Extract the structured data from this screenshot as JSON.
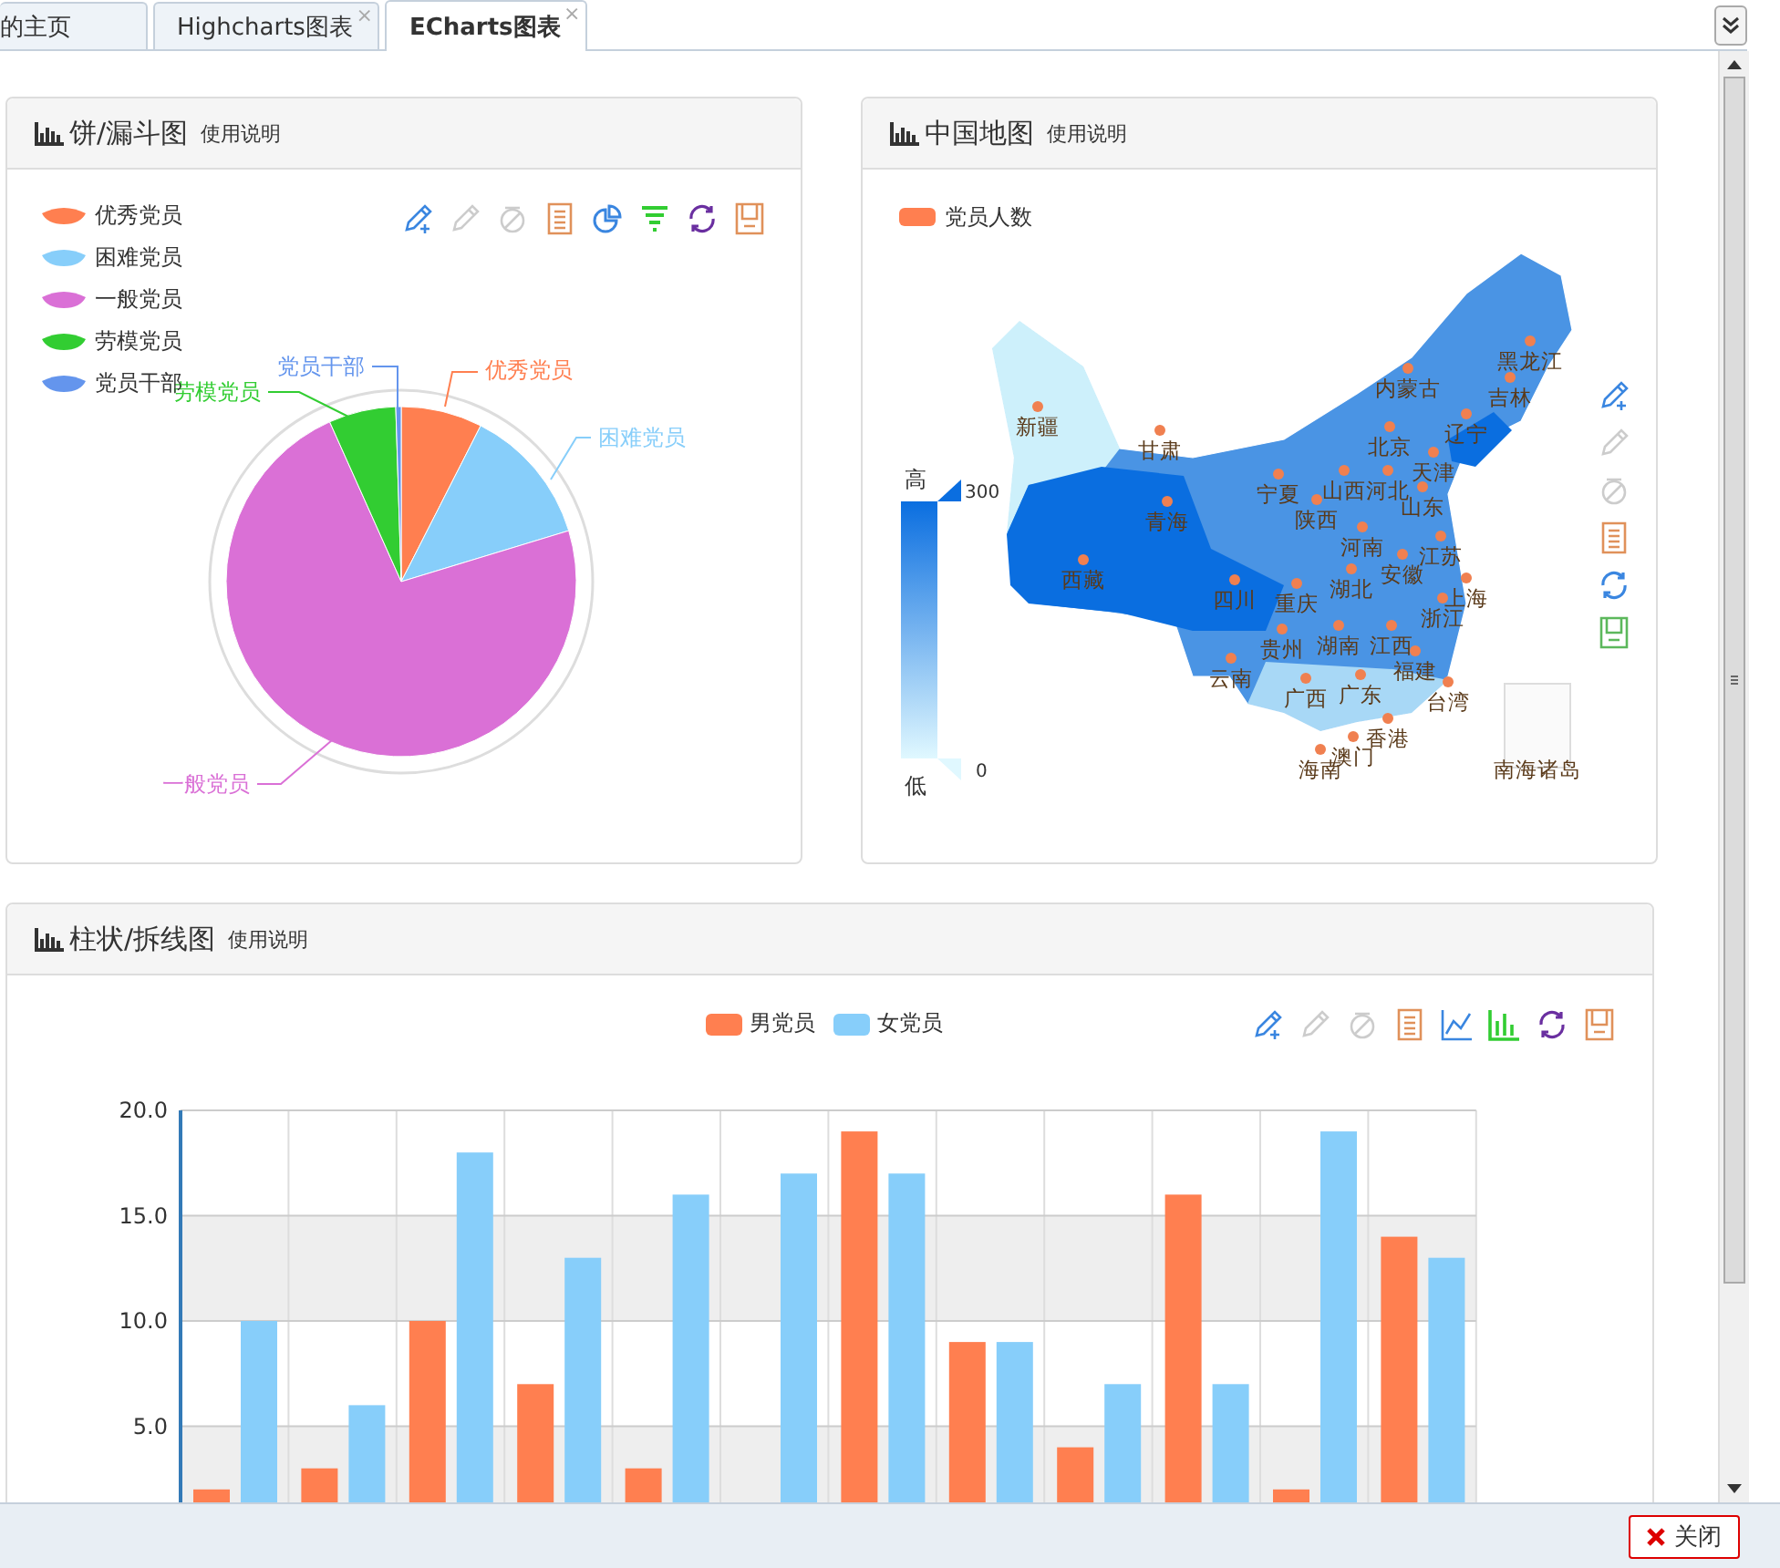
{
  "tabs": [
    {
      "label": "的主页",
      "selected": false
    },
    {
      "label": "Highcharts图表",
      "close": "×",
      "selected": false
    },
    {
      "label": "ECharts图表",
      "close": "×",
      "selected": true
    }
  ],
  "pie_panel": {
    "title": "饼/漏斗图",
    "help": "使用说明",
    "legend": [
      {
        "label": "优秀党员",
        "color": "#ff7f50"
      },
      {
        "label": "困难党员",
        "color": "#87cefa"
      },
      {
        "label": "一般党员",
        "color": "#da70d6"
      },
      {
        "label": "劳模党员",
        "color": "#32cd32"
      },
      {
        "label": "党员干部",
        "color": "#6495ed"
      }
    ],
    "slice_labels": [
      "优秀党员",
      "困难党员",
      "一般党员",
      "劳模党员",
      "党员干部"
    ]
  },
  "map_panel": {
    "title": "中国地图",
    "help": "使用说明",
    "legend": "党员人数",
    "scale_high": "高",
    "scale_low": "低",
    "scale_max": "300",
    "scale_min": "0",
    "provinces": [
      "新疆",
      "甘肃",
      "青海",
      "西藏",
      "内蒙古",
      "黑龙江",
      "吉林",
      "辽宁",
      "北京",
      "天津",
      "宁夏",
      "山西",
      "河北",
      "陕西",
      "山东",
      "河南",
      "江苏",
      "安徽",
      "上海",
      "湖北",
      "四川",
      "重庆",
      "浙江",
      "贵州",
      "湖南",
      "江西",
      "福建",
      "云南",
      "广西",
      "广东",
      "台湾",
      "香港",
      "澳门",
      "海南"
    ],
    "inset_label": "南海诸岛"
  },
  "bar_panel": {
    "title": "柱状/拆线图",
    "help": "使用说明",
    "chart_data": {
      "type": "bar",
      "grid": true,
      "ylim": [
        0,
        20
      ],
      "yticks": [
        {
          "value": 5,
          "label": "5.0"
        },
        {
          "value": 10,
          "label": "10.0"
        },
        {
          "value": 15,
          "label": "15.0"
        },
        {
          "value": 20,
          "label": "20.0"
        }
      ],
      "series": [
        {
          "name": "男党员",
          "color": "#ff7f50",
          "values": [
            2,
            3,
            10,
            7,
            3,
            0,
            19,
            9,
            4,
            16,
            2,
            14
          ]
        },
        {
          "name": "女党员",
          "color": "#87cefa",
          "values": [
            10,
            6,
            18,
            13,
            16,
            17,
            17,
            9,
            7,
            7,
            19,
            13
          ]
        }
      ]
    }
  },
  "close_button": "关闭"
}
